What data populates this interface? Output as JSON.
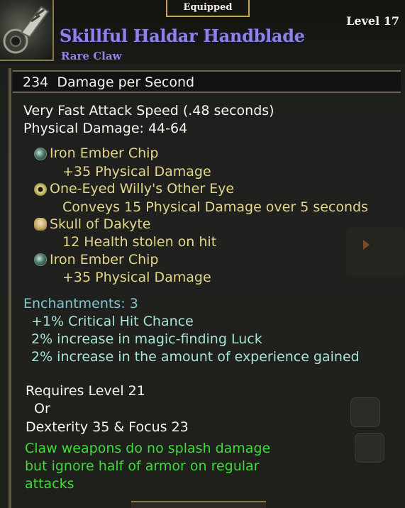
{
  "header": {
    "badge": "Equipped",
    "item_name": "Skillful Haldar Handblade",
    "item_type": "Rare Claw",
    "level": "Level 17",
    "icon": "claw-weapon-icon"
  },
  "dps": {
    "value": "234",
    "label": "Damage per Second"
  },
  "stats": {
    "attack_speed": "Very Fast Attack Speed (.48 seconds)",
    "physical_damage": "Physical Damage: 44-64"
  },
  "sockets": [
    {
      "name": "Iron Ember Chip",
      "effect": "+35 Physical Damage",
      "icon": "gem-chip-icon"
    },
    {
      "name": "One-Eyed Willy's Other Eye",
      "effect": "Conveys 15 Physical Damage over 5 seconds",
      "icon": "eye-gem-icon"
    },
    {
      "name": "Skull of Dakyte",
      "effect": "12 Health stolen on hit",
      "icon": "skull-icon"
    },
    {
      "name": "Iron Ember Chip",
      "effect": "+35 Physical Damage",
      "icon": "gem-chip-icon"
    }
  ],
  "enchantments": {
    "title": "Enchantments: 3",
    "items": [
      "+1% Critical Hit Chance",
      "2% increase in magic-finding Luck",
      "2% increase in the amount of experience gained"
    ]
  },
  "requirements": {
    "level": "Requires Level 21",
    "or": "Or",
    "stats": "Dexterity 35 & Focus 23"
  },
  "note": {
    "line1": "Claw weapons do no splash damage",
    "line2": "but ignore half of armor on regular",
    "line3": "attacks"
  },
  "colors": {
    "item_name": "#8f84e6",
    "socket_name": "#e3d68a",
    "enchant_title": "#7fc7cf",
    "note": "#3fdb3a"
  }
}
